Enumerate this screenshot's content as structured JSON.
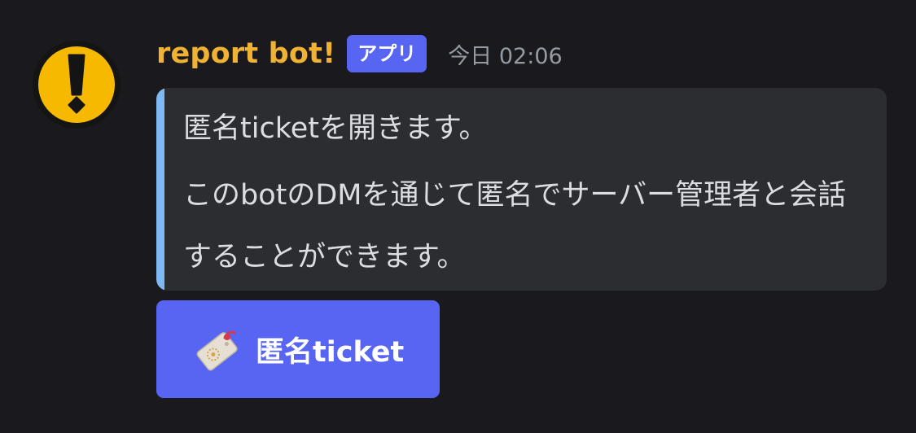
{
  "message": {
    "author": "report bot!",
    "badge": "アプリ",
    "timestamp": "今日 02:06",
    "avatar_icon": "exclamation-warning-icon"
  },
  "embed": {
    "accent_color": "#80b7f5",
    "line1": "匿名ticketを開きます。",
    "line2": "このbotのDMを通じて匿名でサーバー管理者と会話することができます。"
  },
  "button": {
    "label": "匿名ticket",
    "icon": "ticket-tag-icon",
    "color": "#5865f2"
  },
  "colors": {
    "background": "#1a1a1e",
    "author": "#f0b232",
    "embed_background": "#2b2d31",
    "timestamp": "#949ba4"
  }
}
